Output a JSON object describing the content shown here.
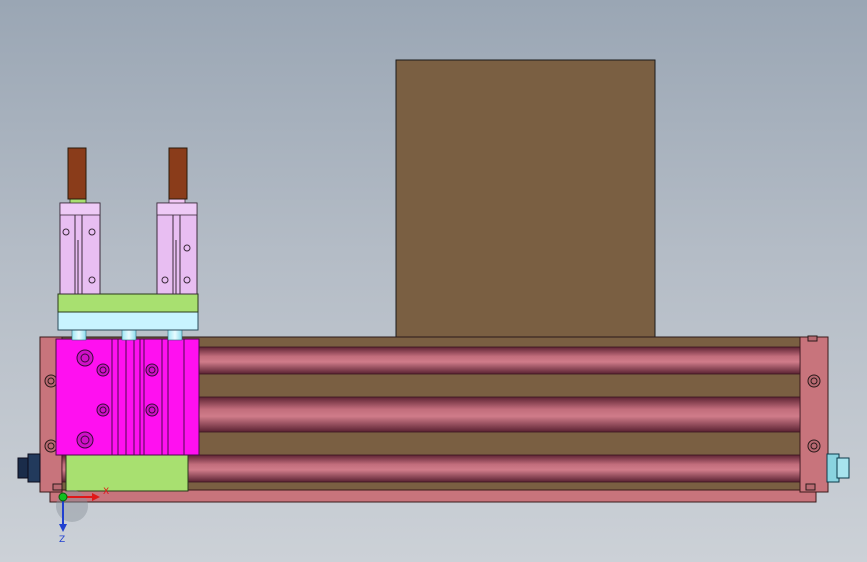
{
  "triad": {
    "x_label": "X",
    "z_label": "Z",
    "x_color": "#e01818",
    "z_color": "#2040d0",
    "origin_color": "#10c020"
  },
  "colors": {
    "background_top": "#9aa6b4",
    "background_bottom": "#ccd1d7",
    "box": "#7a5f42",
    "frame": "#c8747c",
    "roller_dark": "#6b2e3e",
    "roller_light": "#c9707f",
    "plate_green": "#a8e070",
    "plate_cyan": "#c8f4ff",
    "cylinder_magenta": "#ff10f0",
    "gripper_lilac": "#e8bef2",
    "finger_brown": "#8a3c1a",
    "knob_navy": "#1a2c4a",
    "knob_cyan": "#8ad4e0"
  },
  "components": [
    {
      "name": "large-box",
      "icon": "rectangle"
    },
    {
      "name": "roller-conveyor-frame",
      "icon": "frame"
    },
    {
      "name": "rollers",
      "count": 3
    },
    {
      "name": "pneumatic-slide-cylinder",
      "icon": "cylinder"
    },
    {
      "name": "gripper-jaws",
      "count": 2
    }
  ]
}
